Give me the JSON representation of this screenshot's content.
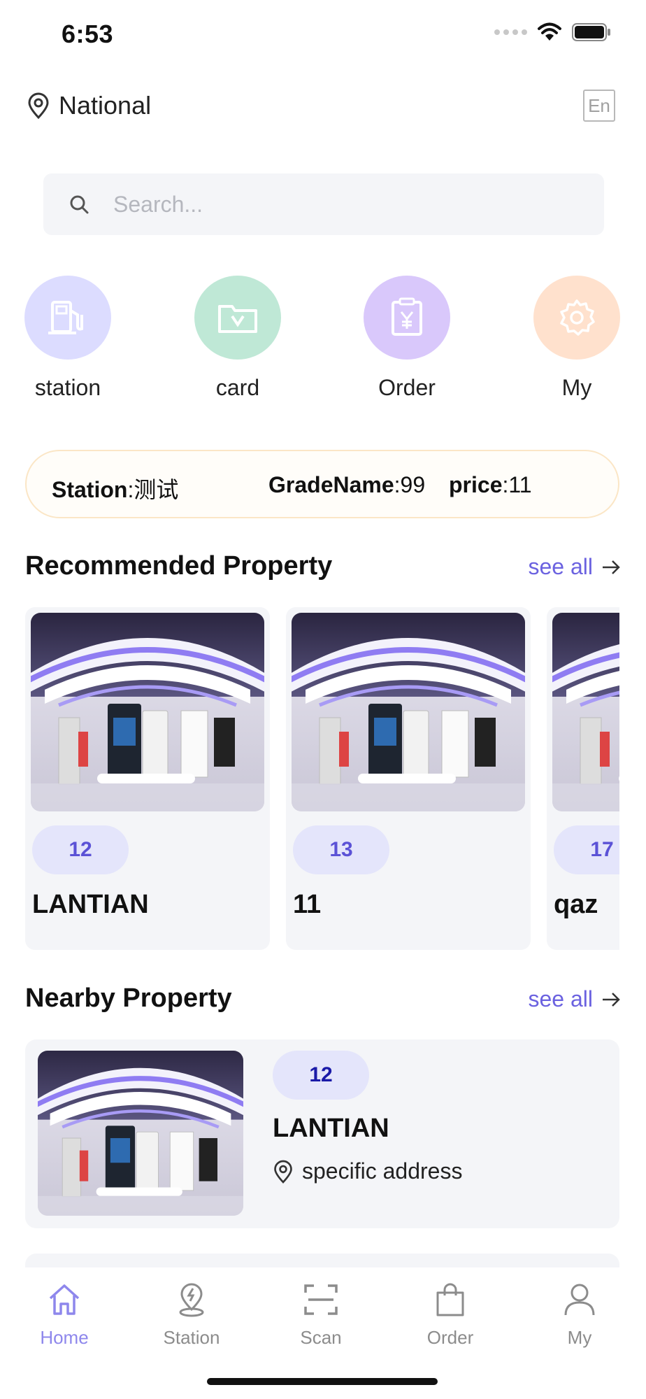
{
  "status_bar": {
    "time": "6:53"
  },
  "header": {
    "location": "National",
    "lang_toggle": "En"
  },
  "search": {
    "placeholder": "Search..."
  },
  "quick_actions": [
    {
      "label": "station",
      "icon": "fuel-pump-icon",
      "color": "#dcdcff"
    },
    {
      "label": "card",
      "icon": "card-folder-icon",
      "color": "#bfe8d6"
    },
    {
      "label": "Order",
      "icon": "yen-receipt-icon",
      "color": "#d9c8fb"
    },
    {
      "label": "My",
      "icon": "gear-icon",
      "color": "#ffe1cd"
    }
  ],
  "info_banner": {
    "station_label": "Station",
    "station_value": ":测试",
    "grade_label": "GradeName",
    "grade_value": ":99",
    "price_label": "price",
    "price_value": ":11"
  },
  "recommended": {
    "title": "Recommended Property",
    "see_all": "see all",
    "items": [
      {
        "badge": "12",
        "name": "LANTIAN"
      },
      {
        "badge": "13",
        "name": "11"
      },
      {
        "badge": "17",
        "name": "qaz"
      }
    ]
  },
  "nearby": {
    "title": "Nearby Property",
    "see_all": "see all",
    "items": [
      {
        "badge": "12",
        "name": "LANTIAN",
        "address": "specific address"
      }
    ]
  },
  "bottom_nav": [
    {
      "label": "Home",
      "icon": "home-icon",
      "active": true
    },
    {
      "label": "Station",
      "icon": "station-pin-icon",
      "active": false
    },
    {
      "label": "Scan",
      "icon": "scan-icon",
      "active": false
    },
    {
      "label": "Order",
      "icon": "shopping-bag-icon",
      "active": false
    },
    {
      "label": "My",
      "icon": "user-icon",
      "active": false
    }
  ],
  "colors": {
    "accent": "#6b62e0",
    "badge_bg": "#e4e5fb",
    "card_bg": "#f4f5f8",
    "nav_active": "#8e87ec",
    "banner_border": "#fbe6c6"
  }
}
